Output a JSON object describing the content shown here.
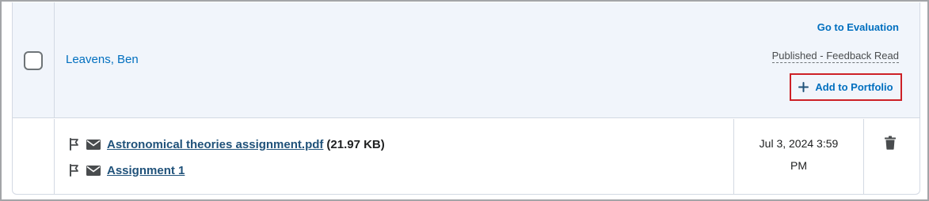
{
  "student": {
    "name": "Leavens, Ben",
    "go_to_evaluation": "Go to Evaluation",
    "status": "Published - Feedback Read",
    "add_to_portfolio": "Add to Portfolio"
  },
  "submission": {
    "files": [
      {
        "name": "Astronomical theories assignment.pdf",
        "size": "(21.97 KB)",
        "icons": [
          "flag-icon",
          "mail-icon"
        ]
      },
      {
        "name": "Assignment 1",
        "size": "",
        "icons": [
          "flag-icon",
          "mail-icon"
        ]
      }
    ],
    "date": "Jul 3, 2024 3:59 PM",
    "delete_icon": "trash-icon"
  },
  "colors": {
    "link": "#006fbf",
    "file_link": "#20527a",
    "header_bg": "#f1f5fb",
    "focus_border": "#cd2026"
  }
}
